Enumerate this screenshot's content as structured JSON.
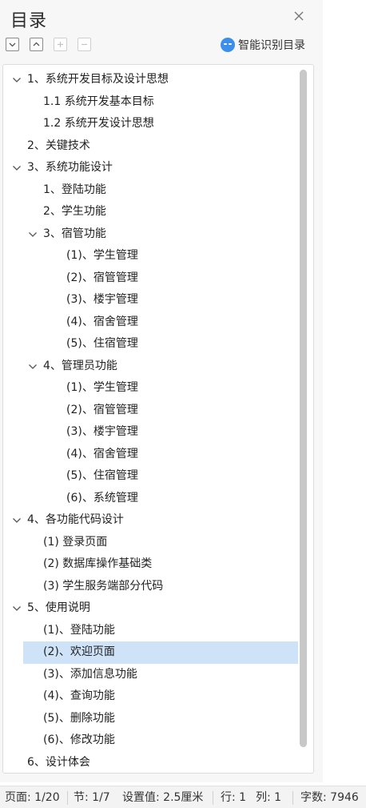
{
  "panel": {
    "title": "目录",
    "smart_label": "智能识别目录"
  },
  "toolbar": {
    "buttons": [
      {
        "name": "expand-all-button",
        "icon": "chevron-down-icon",
        "enabled": true
      },
      {
        "name": "collapse-all-button",
        "icon": "chevron-up-icon",
        "enabled": true
      },
      {
        "name": "add-level-button",
        "icon": "plus-icon",
        "enabled": false
      },
      {
        "name": "remove-level-button",
        "icon": "minus-icon",
        "enabled": false
      }
    ]
  },
  "toc": {
    "items": [
      {
        "label": "1、系统开发目标及设计思想",
        "level": 0,
        "expandable": true
      },
      {
        "label": "1.1  系统开发基本目标",
        "level": 1,
        "expandable": false
      },
      {
        "label": "1.2  系统开发设计思想",
        "level": 1,
        "expandable": false
      },
      {
        "label": "2、关键技术",
        "level": 0,
        "expandable": false
      },
      {
        "label": "3、系统功能设计",
        "level": 0,
        "expandable": true
      },
      {
        "label": "1、登陆功能",
        "level": 1,
        "expandable": false
      },
      {
        "label": "2、学生功能",
        "level": 1,
        "expandable": false
      },
      {
        "label": "3、宿管功能",
        "level": 1,
        "expandable": true
      },
      {
        "label": "(1)、学生管理",
        "level": 2,
        "expandable": false
      },
      {
        "label": "(2)、宿管管理",
        "level": 2,
        "expandable": false
      },
      {
        "label": "(3)、楼宇管理",
        "level": 2,
        "expandable": false
      },
      {
        "label": "(4)、宿舍管理",
        "level": 2,
        "expandable": false
      },
      {
        "label": "(5)、住宿管理",
        "level": 2,
        "expandable": false
      },
      {
        "label": "4、管理员功能",
        "level": 1,
        "expandable": true
      },
      {
        "label": "(1)、学生管理",
        "level": 2,
        "expandable": false
      },
      {
        "label": "(2)、宿管管理",
        "level": 2,
        "expandable": false
      },
      {
        "label": "(3)、楼宇管理",
        "level": 2,
        "expandable": false
      },
      {
        "label": "(4)、宿舍管理",
        "level": 2,
        "expandable": false
      },
      {
        "label": "(5)、住宿管理",
        "level": 2,
        "expandable": false
      },
      {
        "label": "(6)、系统管理",
        "level": 2,
        "expandable": false
      },
      {
        "label": "4、各功能代码设计",
        "level": 0,
        "expandable": true
      },
      {
        "label": "(1) 登录页面",
        "level": 1,
        "expandable": false
      },
      {
        "label": "(2) 数据库操作基础类",
        "level": 1,
        "expandable": false
      },
      {
        "label": "(3) 学生服务端部分代码",
        "level": 1,
        "expandable": false
      },
      {
        "label": "5、使用说明",
        "level": 0,
        "expandable": true
      },
      {
        "label": "(1)、登陆功能",
        "level": 1,
        "expandable": false
      },
      {
        "label": "(2)、欢迎页面",
        "level": 1,
        "expandable": false,
        "selected": true
      },
      {
        "label": "(3)、添加信息功能",
        "level": 1,
        "expandable": false
      },
      {
        "label": "(4)、查询功能",
        "level": 1,
        "expandable": false
      },
      {
        "label": "(5)、删除功能",
        "level": 1,
        "expandable": false
      },
      {
        "label": "(6)、修改功能",
        "level": 1,
        "expandable": false
      },
      {
        "label": "6、设计体会",
        "level": 0,
        "expandable": false
      }
    ]
  },
  "status": {
    "page": "页面: 1/20",
    "section": "节: 1/7",
    "setting": "设置值: 2.5厘米",
    "line": "行: 1",
    "column": "列: 1",
    "word_count": "字数: 7946"
  },
  "colors": {
    "selected_row": "#cfe3f8",
    "ai_icon": "#3b8ee9"
  }
}
